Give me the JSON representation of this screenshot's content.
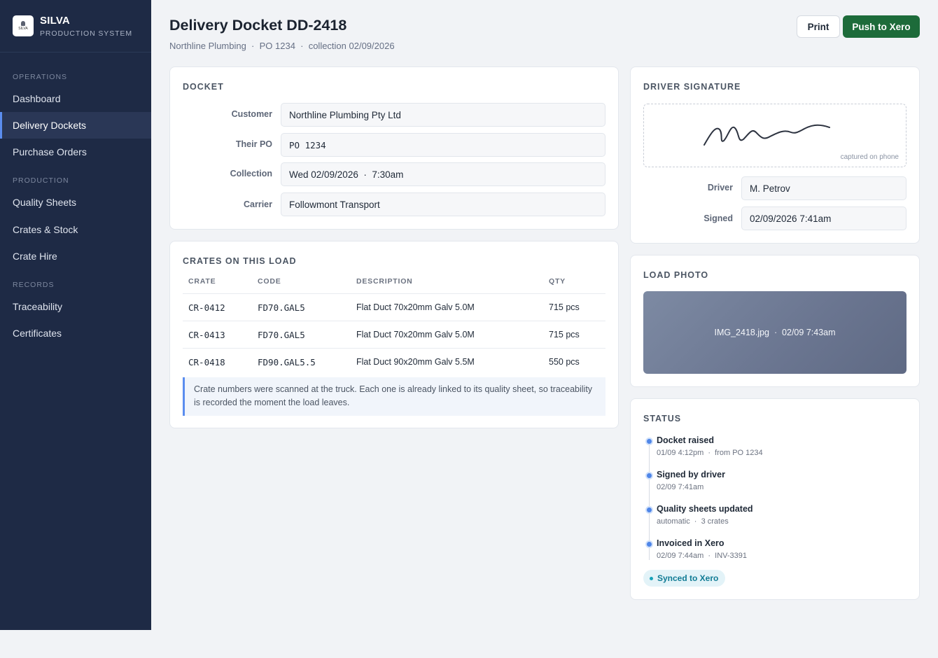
{
  "brand": {
    "name": "SILVA",
    "subtitle": "PRODUCTION SYSTEM",
    "logo_text": "SILVA"
  },
  "sidebar": {
    "sections": [
      {
        "title": "OPERATIONS",
        "items": [
          {
            "label": "Dashboard"
          },
          {
            "label": "Delivery Dockets",
            "active": true
          },
          {
            "label": "Purchase Orders"
          }
        ]
      },
      {
        "title": "PRODUCTION",
        "items": [
          {
            "label": "Quality Sheets"
          },
          {
            "label": "Crates & Stock"
          },
          {
            "label": "Crate Hire"
          }
        ]
      },
      {
        "title": "RECORDS",
        "items": [
          {
            "label": "Traceability"
          },
          {
            "label": "Certificates"
          }
        ]
      }
    ]
  },
  "header": {
    "title": "Delivery Docket DD-2418",
    "subtitle": "Northline Plumbing  ·  PO 1234  ·  collection 02/09/2026",
    "print_label": "Print",
    "push_label": "Push to Xero"
  },
  "docket": {
    "title": "DOCKET",
    "fields": [
      {
        "label": "Customer",
        "value": "Northline Plumbing Pty Ltd"
      },
      {
        "label": "Their PO",
        "value": "PO 1234"
      },
      {
        "label": "Collection",
        "value": "Wed 02/09/2026  ·  7:30am"
      },
      {
        "label": "Carrier",
        "value": "Followmont Transport"
      }
    ]
  },
  "crates": {
    "title": "CRATES ON THIS LOAD",
    "columns": [
      "CRATE",
      "CODE",
      "DESCRIPTION",
      "QTY"
    ],
    "rows": [
      [
        "CR-0412",
        "FD70.GAL5",
        "Flat Duct 70x20mm Galv 5.0M",
        "715 pcs"
      ],
      [
        "CR-0413",
        "FD70.GAL5",
        "Flat Duct 70x20mm Galv 5.0M",
        "715 pcs"
      ],
      [
        "CR-0418",
        "FD90.GAL5.5",
        "Flat Duct 90x20mm Galv 5.5M",
        "550 pcs"
      ]
    ],
    "note_line1": "Crate numbers were scanned at the truck. Each one is already linked to its quality sheet, so traceability",
    "note_line2": "is recorded the moment the load leaves."
  },
  "signature": {
    "title": "DRIVER SIGNATURE",
    "caption": "captured on phone",
    "driver_label": "Driver",
    "driver_value": "M. Petrov",
    "signed_label": "Signed",
    "signed_value": "02/09/2026 7:41am"
  },
  "photo": {
    "title": "LOAD PHOTO",
    "caption": "IMG_2418.jpg  ·  02/09 7:43am"
  },
  "status": {
    "title": "STATUS",
    "events": [
      {
        "title": "Docket raised",
        "detail": "01/09 4:12pm  ·  from PO 1234"
      },
      {
        "title": "Signed by driver",
        "detail": "02/09 7:41am"
      },
      {
        "title": "Quality sheets updated",
        "detail": "automatic  ·  3 crates"
      },
      {
        "title": "Invoiced in Xero",
        "detail": "02/09 7:44am  ·  INV-3391"
      }
    ],
    "badge": "Synced to Xero"
  },
  "colors": {
    "sidebar": "#1e2a45",
    "accent": "#5b8def",
    "primary_button": "#1d6b3a",
    "badge": "#117c95"
  }
}
